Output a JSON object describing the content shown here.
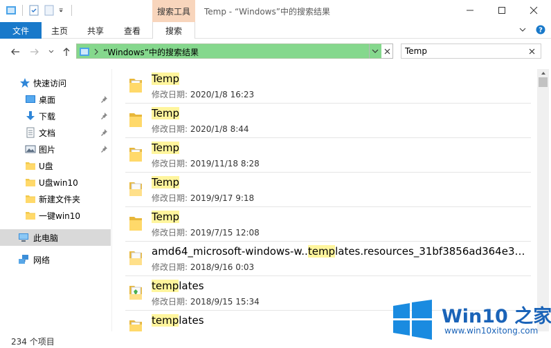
{
  "window": {
    "title": "Temp - “Windows”中的搜索结果",
    "context_tab": "搜索工具"
  },
  "ribbon": {
    "tabs": [
      {
        "label": "文件"
      },
      {
        "label": "主页"
      },
      {
        "label": "共享"
      },
      {
        "label": "查看"
      },
      {
        "label": "搜索"
      }
    ],
    "active_tab": "搜索"
  },
  "address": {
    "path": "“Windows”中的搜索结果",
    "highlight_color": "#85d88d"
  },
  "search": {
    "value": "Temp"
  },
  "sidebar": {
    "items": [
      {
        "label": "快速访问",
        "icon": "star-icon"
      },
      {
        "label": "桌面",
        "icon": "desktop-icon",
        "pinned": true
      },
      {
        "label": "下载",
        "icon": "download-icon",
        "pinned": true
      },
      {
        "label": "文档",
        "icon": "document-icon",
        "pinned": true
      },
      {
        "label": "图片",
        "icon": "pictures-icon",
        "pinned": true
      },
      {
        "label": "U盘",
        "icon": "folder-icon"
      },
      {
        "label": "U盘win10",
        "icon": "folder-icon"
      },
      {
        "label": "新建文件夹",
        "icon": "folder-icon"
      },
      {
        "label": "一键win10",
        "icon": "folder-icon"
      },
      {
        "label": "此电脑",
        "icon": "computer-icon"
      },
      {
        "label": "网络",
        "icon": "network-icon"
      }
    ]
  },
  "results": {
    "meta_label": "修改日期:",
    "items": [
      {
        "pre": "",
        "hl": "Temp",
        "post": "",
        "date": "2020/1/8 16:23",
        "icon": "folder-docs-icon"
      },
      {
        "pre": "",
        "hl": "Temp",
        "post": "",
        "date": "2020/1/8 8:44",
        "icon": "folder-icon"
      },
      {
        "pre": "",
        "hl": "Temp",
        "post": "",
        "date": "2019/11/18 8:28",
        "icon": "folder-docs-icon"
      },
      {
        "pre": "",
        "hl": "Temp",
        "post": "",
        "date": "2019/9/17 9:18",
        "icon": "folder-white-icon"
      },
      {
        "pre": "",
        "hl": "Temp",
        "post": "",
        "date": "2019/7/15 12:08",
        "icon": "folder-icon"
      },
      {
        "pre": "amd64_microsoft-windows-w..",
        "hl": "temp",
        "post": "lates.resources_31bf3856ad364e35_...",
        "date": "2018/9/16 0:03",
        "icon": "folder-white-icon"
      },
      {
        "pre": "",
        "hl": "temp",
        "post": "lates",
        "date": "2018/9/15 15:34",
        "icon": "folder-green-icon"
      },
      {
        "pre": "",
        "hl": "temp",
        "post": "lates",
        "date": "",
        "icon": "folder-docs-icon"
      }
    ]
  },
  "status": {
    "count": "234 个项目"
  },
  "watermark": {
    "title": "Win10 之家",
    "url": "www.win10xitong.com",
    "color": "#1a63b8"
  }
}
